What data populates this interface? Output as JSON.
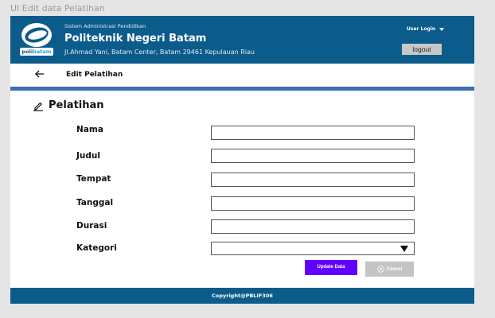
{
  "frame_label": "UI Edit data Pelatihan",
  "header": {
    "logo_text_a": "poli",
    "logo_text_b": "batam",
    "system_name": "Sistem Administrasi Pendidikan",
    "school_name": "Politeknik Negeri Batam",
    "address": "Jl.Ahmad Yani, Batam Center, Batam 29461 Kepulauan Riau",
    "user_login": "User Login",
    "logout_label": "logout"
  },
  "subbar": {
    "title": "Edit Pelatihan"
  },
  "form": {
    "section_title": "Pelatihan",
    "fields": [
      {
        "label": "Nama",
        "value": ""
      },
      {
        "label": "Judul",
        "value": ""
      },
      {
        "label": "Tempat",
        "value": ""
      },
      {
        "label": "Tanggal",
        "value": ""
      },
      {
        "label": "Durasi",
        "value": ""
      },
      {
        "label": "Kategori",
        "value": ""
      }
    ],
    "update_label": "Update Data",
    "cancel_label": "Cancel"
  },
  "footer": {
    "copyright": "Copyright@PBLIF306"
  },
  "colors": {
    "primary": "#0b5c8b",
    "accent_line": "#3b71b1",
    "update_button": "#6200ff",
    "cancel_button": "#c4c4c4"
  }
}
